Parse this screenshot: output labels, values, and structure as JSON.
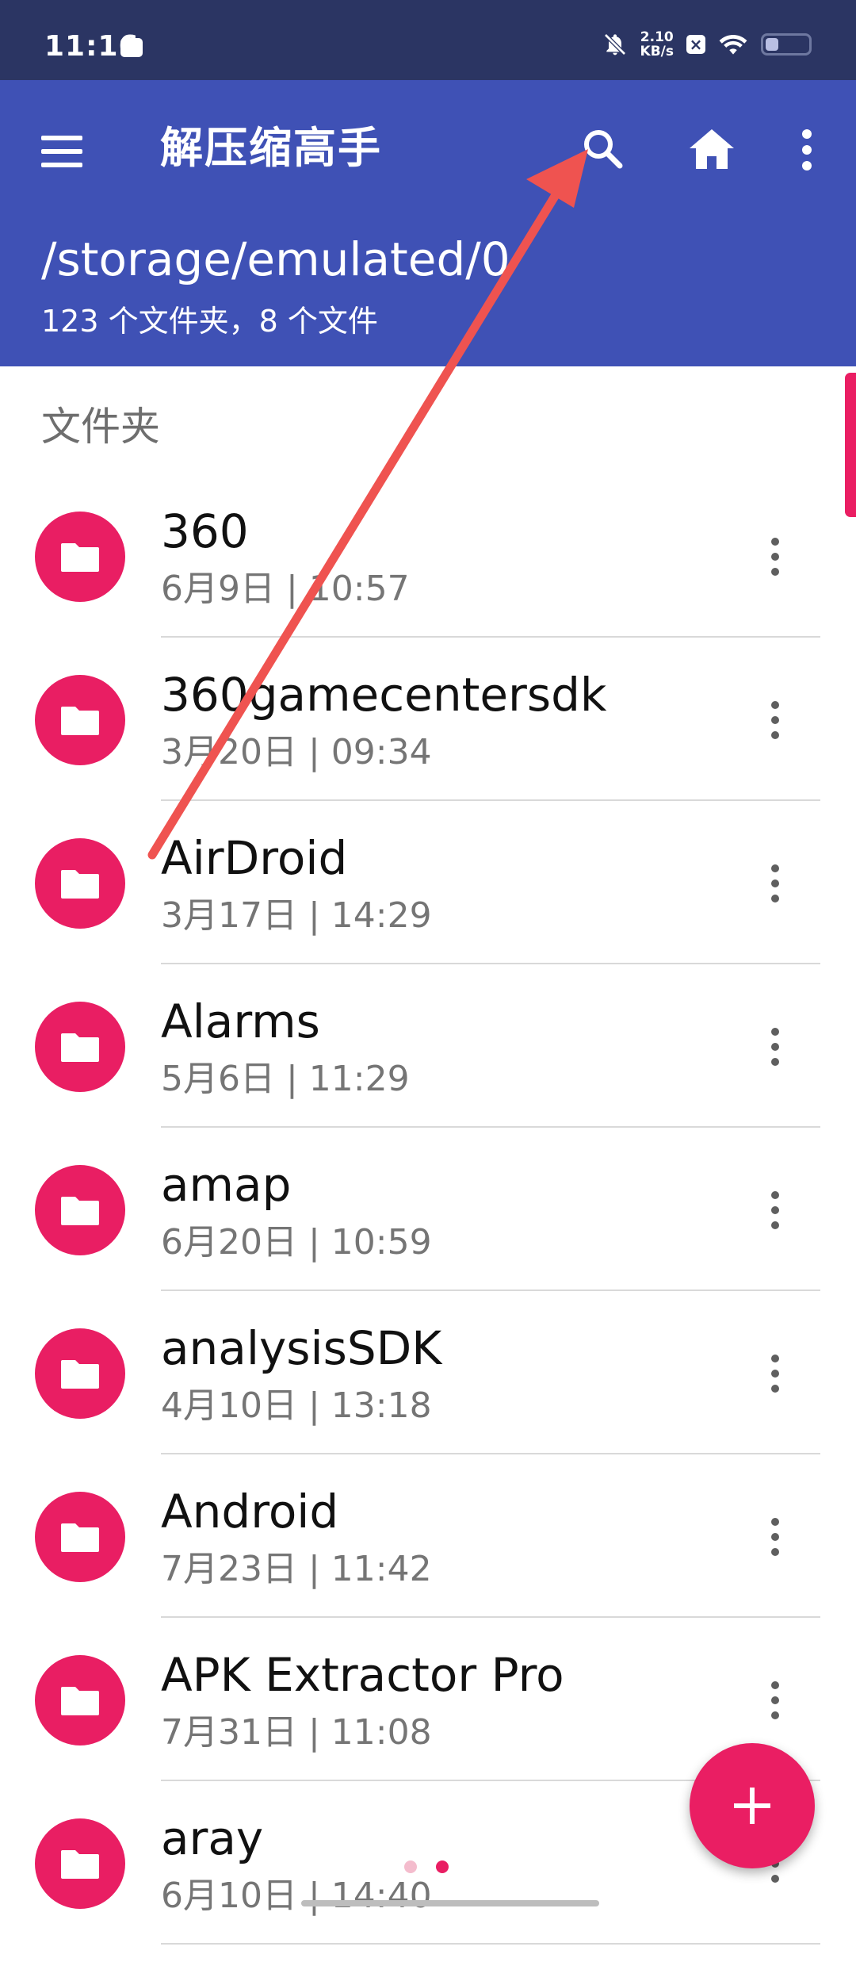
{
  "status_bar": {
    "time": "11:16",
    "net_speed_value": "2.10",
    "net_speed_unit": "KB/s",
    "battery_level": 0.3
  },
  "app_bar": {
    "title": "解压缩高手",
    "path": "/storage/emulated/0",
    "summary": "123 个文件夹，8 个文件"
  },
  "section_header": "文件夹",
  "folders": [
    {
      "name": "360",
      "meta": "6月9日 | 10:57"
    },
    {
      "name": "360gamecentersdk",
      "meta": "3月20日 | 09:34"
    },
    {
      "name": "AirDroid",
      "meta": "3月17日 | 14:29"
    },
    {
      "name": "Alarms",
      "meta": "5月6日 | 11:29"
    },
    {
      "name": "amap",
      "meta": "6月20日 | 10:59"
    },
    {
      "name": "analysisSDK",
      "meta": "4月10日 | 13:18"
    },
    {
      "name": "Android",
      "meta": "7月23日 | 11:42"
    },
    {
      "name": "APK Extractor Pro",
      "meta": "7月31日 | 11:08"
    },
    {
      "name": "aray",
      "meta": "6月10日 | 14:40"
    }
  ],
  "colors": {
    "status_bar": "#2b3563",
    "app_bar": "#3f51b5",
    "accent": "#e91e63",
    "annotation_arrow": "#ef5350"
  },
  "page_indicator": {
    "pages": 2,
    "active": 1
  }
}
